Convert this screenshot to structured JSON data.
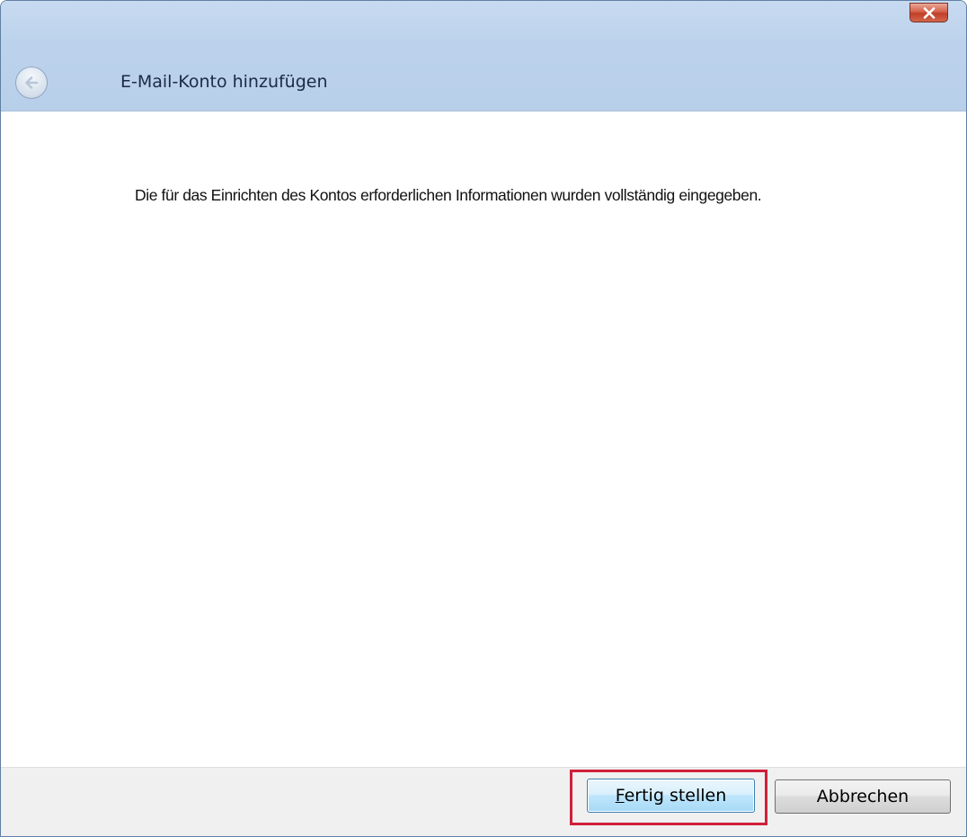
{
  "window": {
    "title": "E-Mail-Konto hinzufügen"
  },
  "content": {
    "message": "Die für das Einrichten des Kontos erforderlichen Informationen wurden vollständig eingegeben."
  },
  "footer": {
    "finish_mnemonic": "F",
    "finish_rest": "ertig stellen",
    "cancel_label": "Abbrechen"
  },
  "icons": {
    "back": "back-arrow-icon",
    "close": "close-icon"
  },
  "colors": {
    "titlebar": "#bcd2ec",
    "close_button": "#c23f28",
    "highlight": "#d0203a",
    "footer": "#f0f0f0"
  }
}
